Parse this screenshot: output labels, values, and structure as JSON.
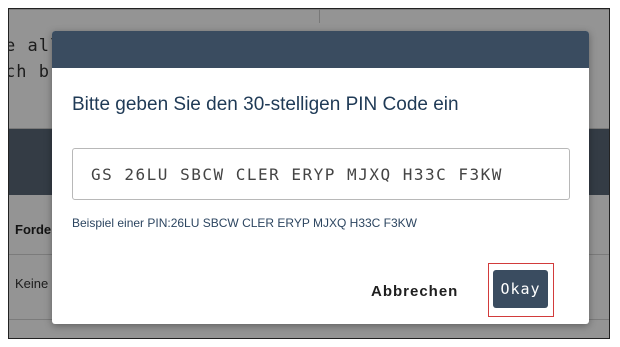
{
  "background": {
    "text_line1": "e all",
    "text_line2": "ch b",
    "column_header": "Forde",
    "row_cell": "Keine"
  },
  "dialog": {
    "title": "Bitte geben Sie den 30-stelligen PIN Code ein",
    "pin_value": "GS 26LU SBCW CLER ERYP MJXQ H33C F3KW",
    "hint": "Beispiel einer PIN:26LU SBCW CLER ERYP MJXQ H33C F3KW",
    "cancel_label": "Abbrechen",
    "ok_label": "Okay"
  },
  "colors": {
    "header": "#3a4c60",
    "primary_button": "#3a4c60",
    "highlight_border": "#d23b3b",
    "title_text": "#1f3a56"
  }
}
